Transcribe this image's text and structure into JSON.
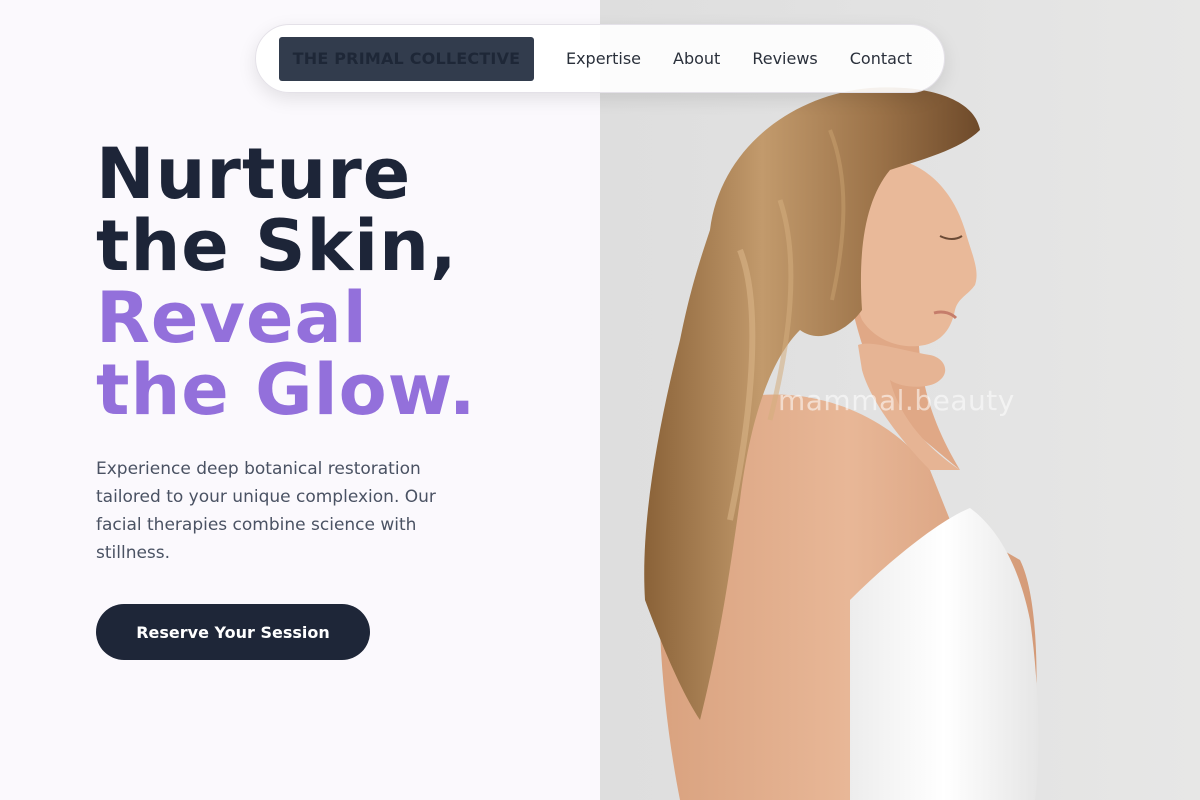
{
  "nav": {
    "brand": "THE PRIMAL COLLECTIVE",
    "links": [
      "Expertise",
      "About",
      "Reviews",
      "Contact"
    ]
  },
  "hero": {
    "headline_dark": [
      "Nurture",
      "the Skin,"
    ],
    "headline_accent": [
      "Reveal",
      "the Glow."
    ],
    "description": "Experience deep botanical restoration tailored to your unique complexion. Our facial therapies combine science with stillness.",
    "cta_label": "Reserve Your Session"
  },
  "photo": {
    "watermark": "mammal.beauty"
  },
  "colors": {
    "background": "#fbf9fd",
    "heading_dark": "#1d2538",
    "accent_purple": "#9370db",
    "cta_background": "#1e2638",
    "brand_background": "#323c4d",
    "photo_background": "#e2e2e2"
  }
}
